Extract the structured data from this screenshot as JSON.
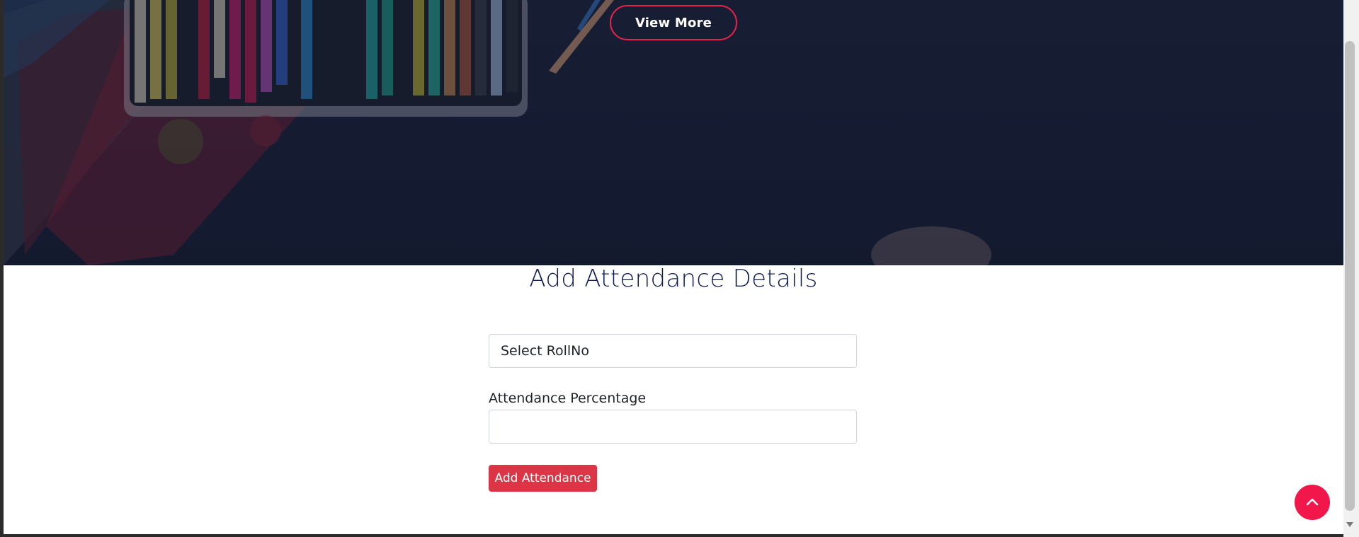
{
  "hero": {
    "view_more_label": "View More"
  },
  "form": {
    "title": "Add Attendance Details",
    "rollno_select": {
      "selected": "Select RollNo"
    },
    "attendance_label": "Attendance Percentage",
    "attendance_value": "",
    "submit_label": "Add Attendance"
  },
  "controls": {
    "back_to_top_icon": "chevron-up-icon"
  },
  "colors": {
    "accent": "#e8234b",
    "button_danger": "#dc3545",
    "title": "#0f1d56",
    "hero_bg": "#161c33"
  }
}
